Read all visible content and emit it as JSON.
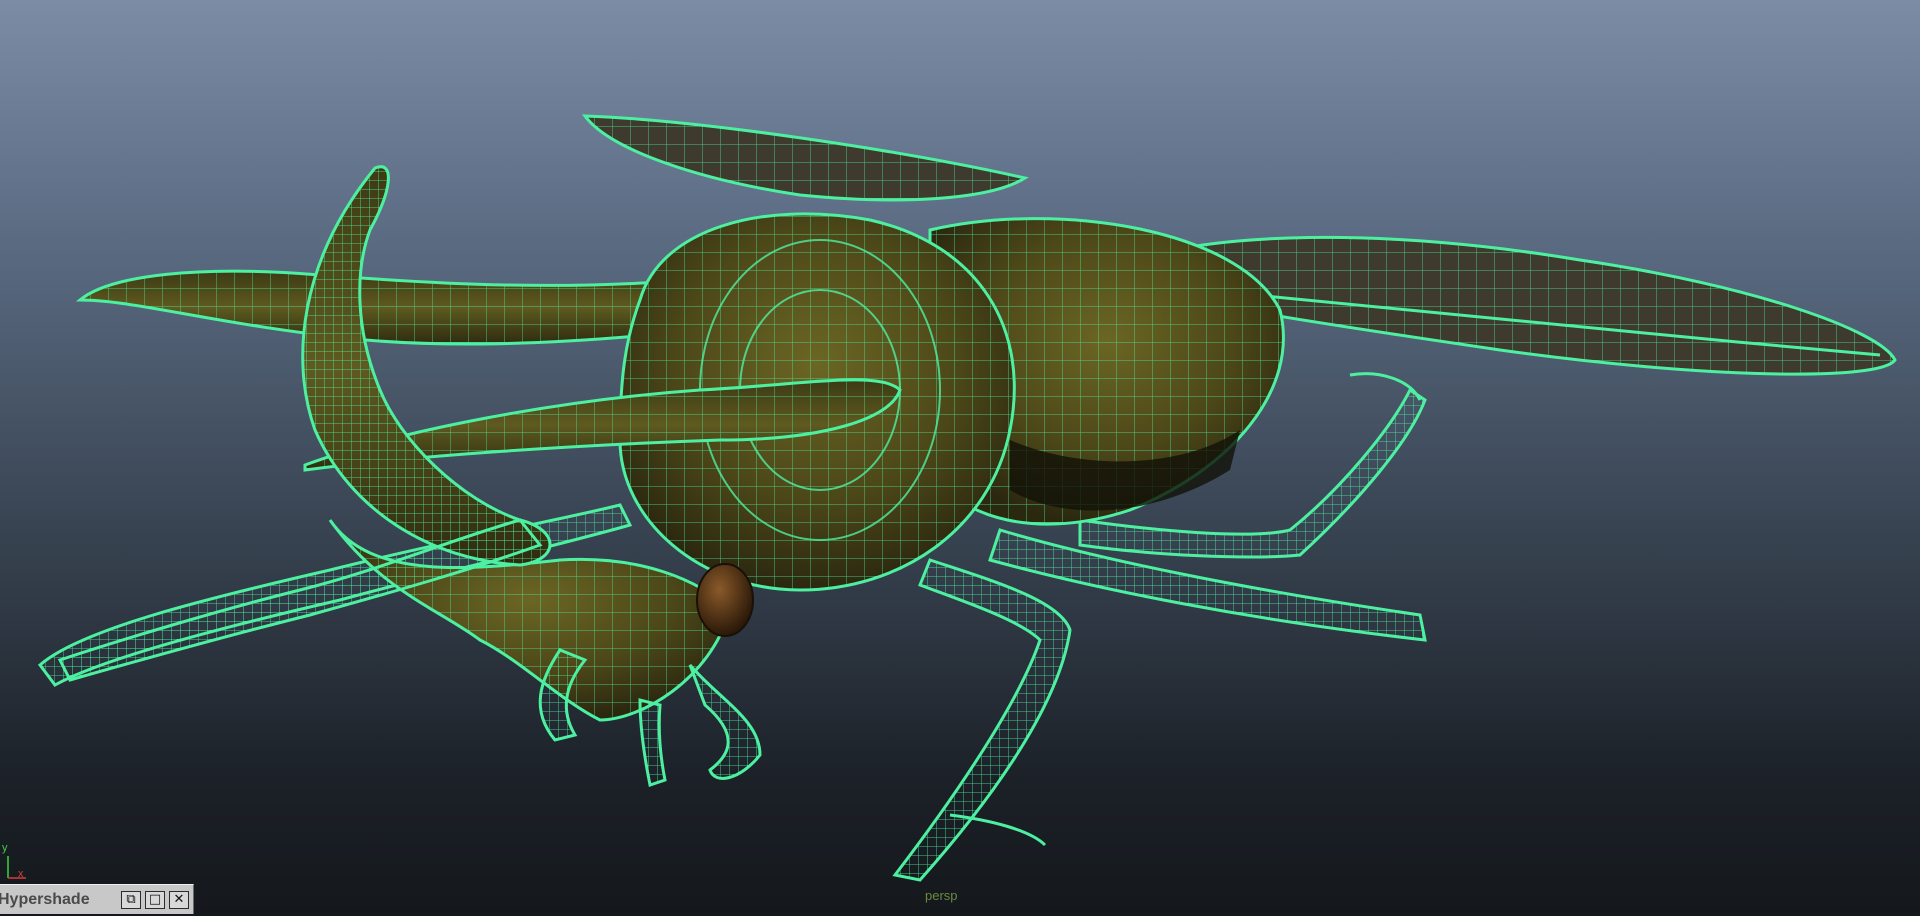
{
  "viewport": {
    "camera_label": "persp",
    "axis": {
      "y": "y",
      "x": "x"
    }
  },
  "hypershade": {
    "title": "Hypershade",
    "restore_glyph": "⧉",
    "maximize_glyph": "□",
    "close_glyph": "✕"
  },
  "colors": {
    "wireframe": "#4df0a0",
    "body_fill": "#4a4418",
    "eye": "#4a2e14",
    "wing": "#3e3a2e"
  }
}
